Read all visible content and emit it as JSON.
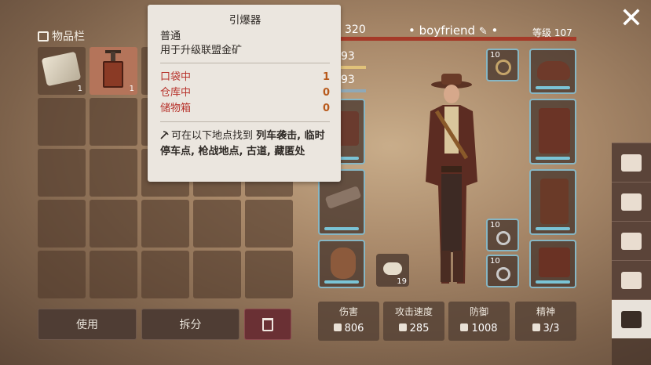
{
  "inventory": {
    "title": "物品栏",
    "slots_row1": [
      {
        "item": "cloth",
        "qty": "1"
      },
      {
        "item": "detonator",
        "qty": "1"
      }
    ]
  },
  "actions": {
    "use": "使用",
    "split": "拆分"
  },
  "tooltip": {
    "title": "引爆器",
    "rarity": "普通",
    "desc": "用于升级联盟金矿",
    "pocket_label": "口袋中",
    "pocket_value": "1",
    "storage_label": "仓库中",
    "storage_value": "0",
    "chest_label": "储物箱",
    "chest_value": "0",
    "find_prefix": "可在以下地点找到",
    "find_locations": "列车袭击, 临时停车点, 枪战地点, 古道, 藏匿处"
  },
  "player": {
    "stat_top": "320",
    "name": "boyfriend",
    "level": "等级 107",
    "stat_a": "93",
    "stat_b": "93"
  },
  "equipment": {
    "accessory_qty": "10",
    "ring1_qty": "10",
    "ring2_qty": "10",
    "consumable_qty": "19"
  },
  "stats": [
    {
      "label": "伤害",
      "value": "806"
    },
    {
      "label": "攻击速度",
      "value": "285"
    },
    {
      "label": "防御",
      "value": "1008"
    },
    {
      "label": "精神",
      "value": "3/3"
    }
  ],
  "colors": {
    "tooltip_bg": "#ebe6df",
    "value_red": "#b7322b",
    "equip_border": "#86b6c4",
    "selected_slot": "#b4745a"
  }
}
